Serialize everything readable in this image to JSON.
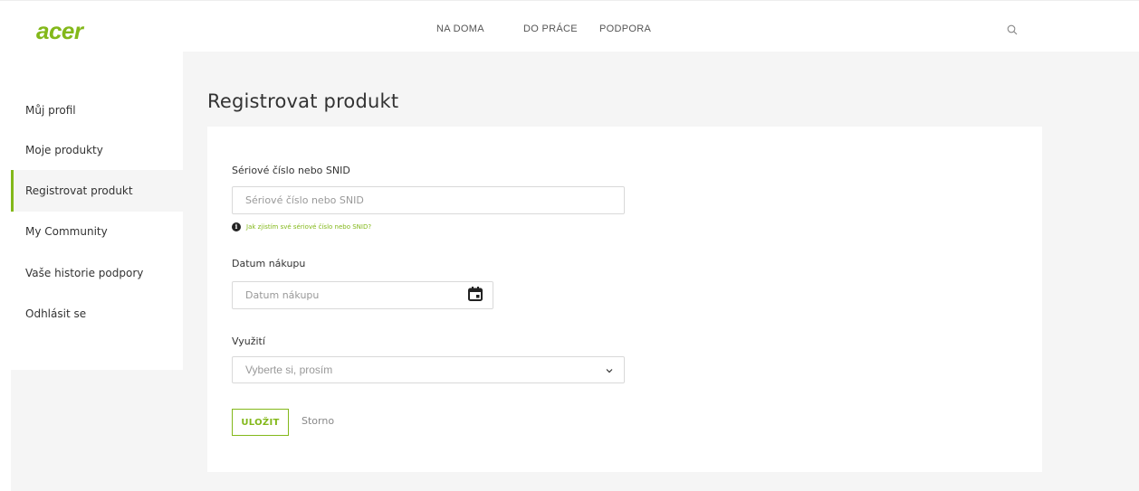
{
  "header": {
    "logo": "acer",
    "nav": [
      "NA DOMA",
      "DO PRÁCE",
      "PODPORA"
    ],
    "search_icon": "search-icon"
  },
  "sidebar": {
    "items": [
      {
        "label": "Můj profil"
      },
      {
        "label": "Moje produkty"
      },
      {
        "label": "Registrovat produkt",
        "active": true
      },
      {
        "label": "My Community"
      },
      {
        "label": "Vaše historie podpory"
      },
      {
        "label": "Odhlásit se"
      }
    ]
  },
  "main": {
    "title": "Registrovat produkt",
    "serial": {
      "label": "Sériové číslo nebo SNID",
      "placeholder": "Sériové číslo nebo SNID",
      "hint": "Jak zjistím své sériové číslo nebo SNID?"
    },
    "date": {
      "label": "Datum nákupu",
      "placeholder": "Datum nákupu"
    },
    "usage": {
      "label": "Využití",
      "selected": "Vyberte si, prosím"
    },
    "actions": {
      "save": "ULOŽIT",
      "cancel": "Storno"
    }
  },
  "colors": {
    "accent": "#83b81a",
    "background": "#f5f5f5"
  }
}
